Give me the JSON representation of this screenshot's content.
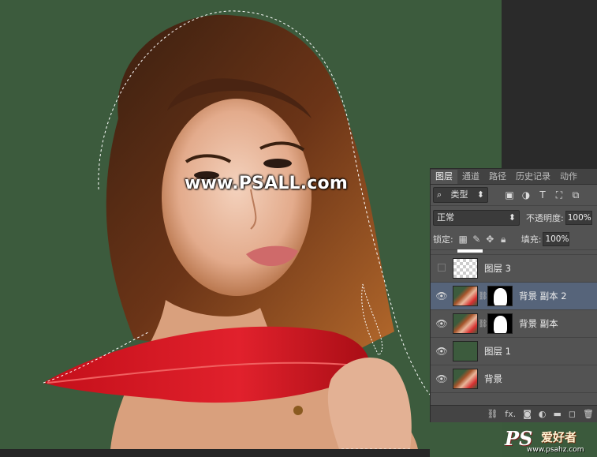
{
  "watermark": "www.PSALL.com",
  "panel": {
    "tabs": [
      "图层",
      "通道",
      "路径",
      "历史记录",
      "动作"
    ],
    "filter_kind": "类型",
    "blend_mode": "正常",
    "opacity_label": "不透明度:",
    "opacity_value": "100%",
    "lock_label": "锁定:",
    "fill_label": "填充:",
    "fill_value": "100%",
    "layers": [
      {
        "name": "图层 3",
        "visible": false
      },
      {
        "name": "背景 副本 2",
        "visible": true,
        "selected": true
      },
      {
        "name": "背景 副本",
        "visible": true
      },
      {
        "name": "图层 1",
        "visible": true
      },
      {
        "name": "背景",
        "visible": true
      }
    ],
    "footer_icons": [
      "link-icon",
      "fx-icon",
      "mask-icon",
      "adjustment-icon",
      "folder-icon",
      "new-layer-icon",
      "trash-icon"
    ],
    "footer_fx": "fx."
  },
  "logo": {
    "ps": "PS",
    "site": "爱好者",
    "url": "www.psahz.com"
  }
}
